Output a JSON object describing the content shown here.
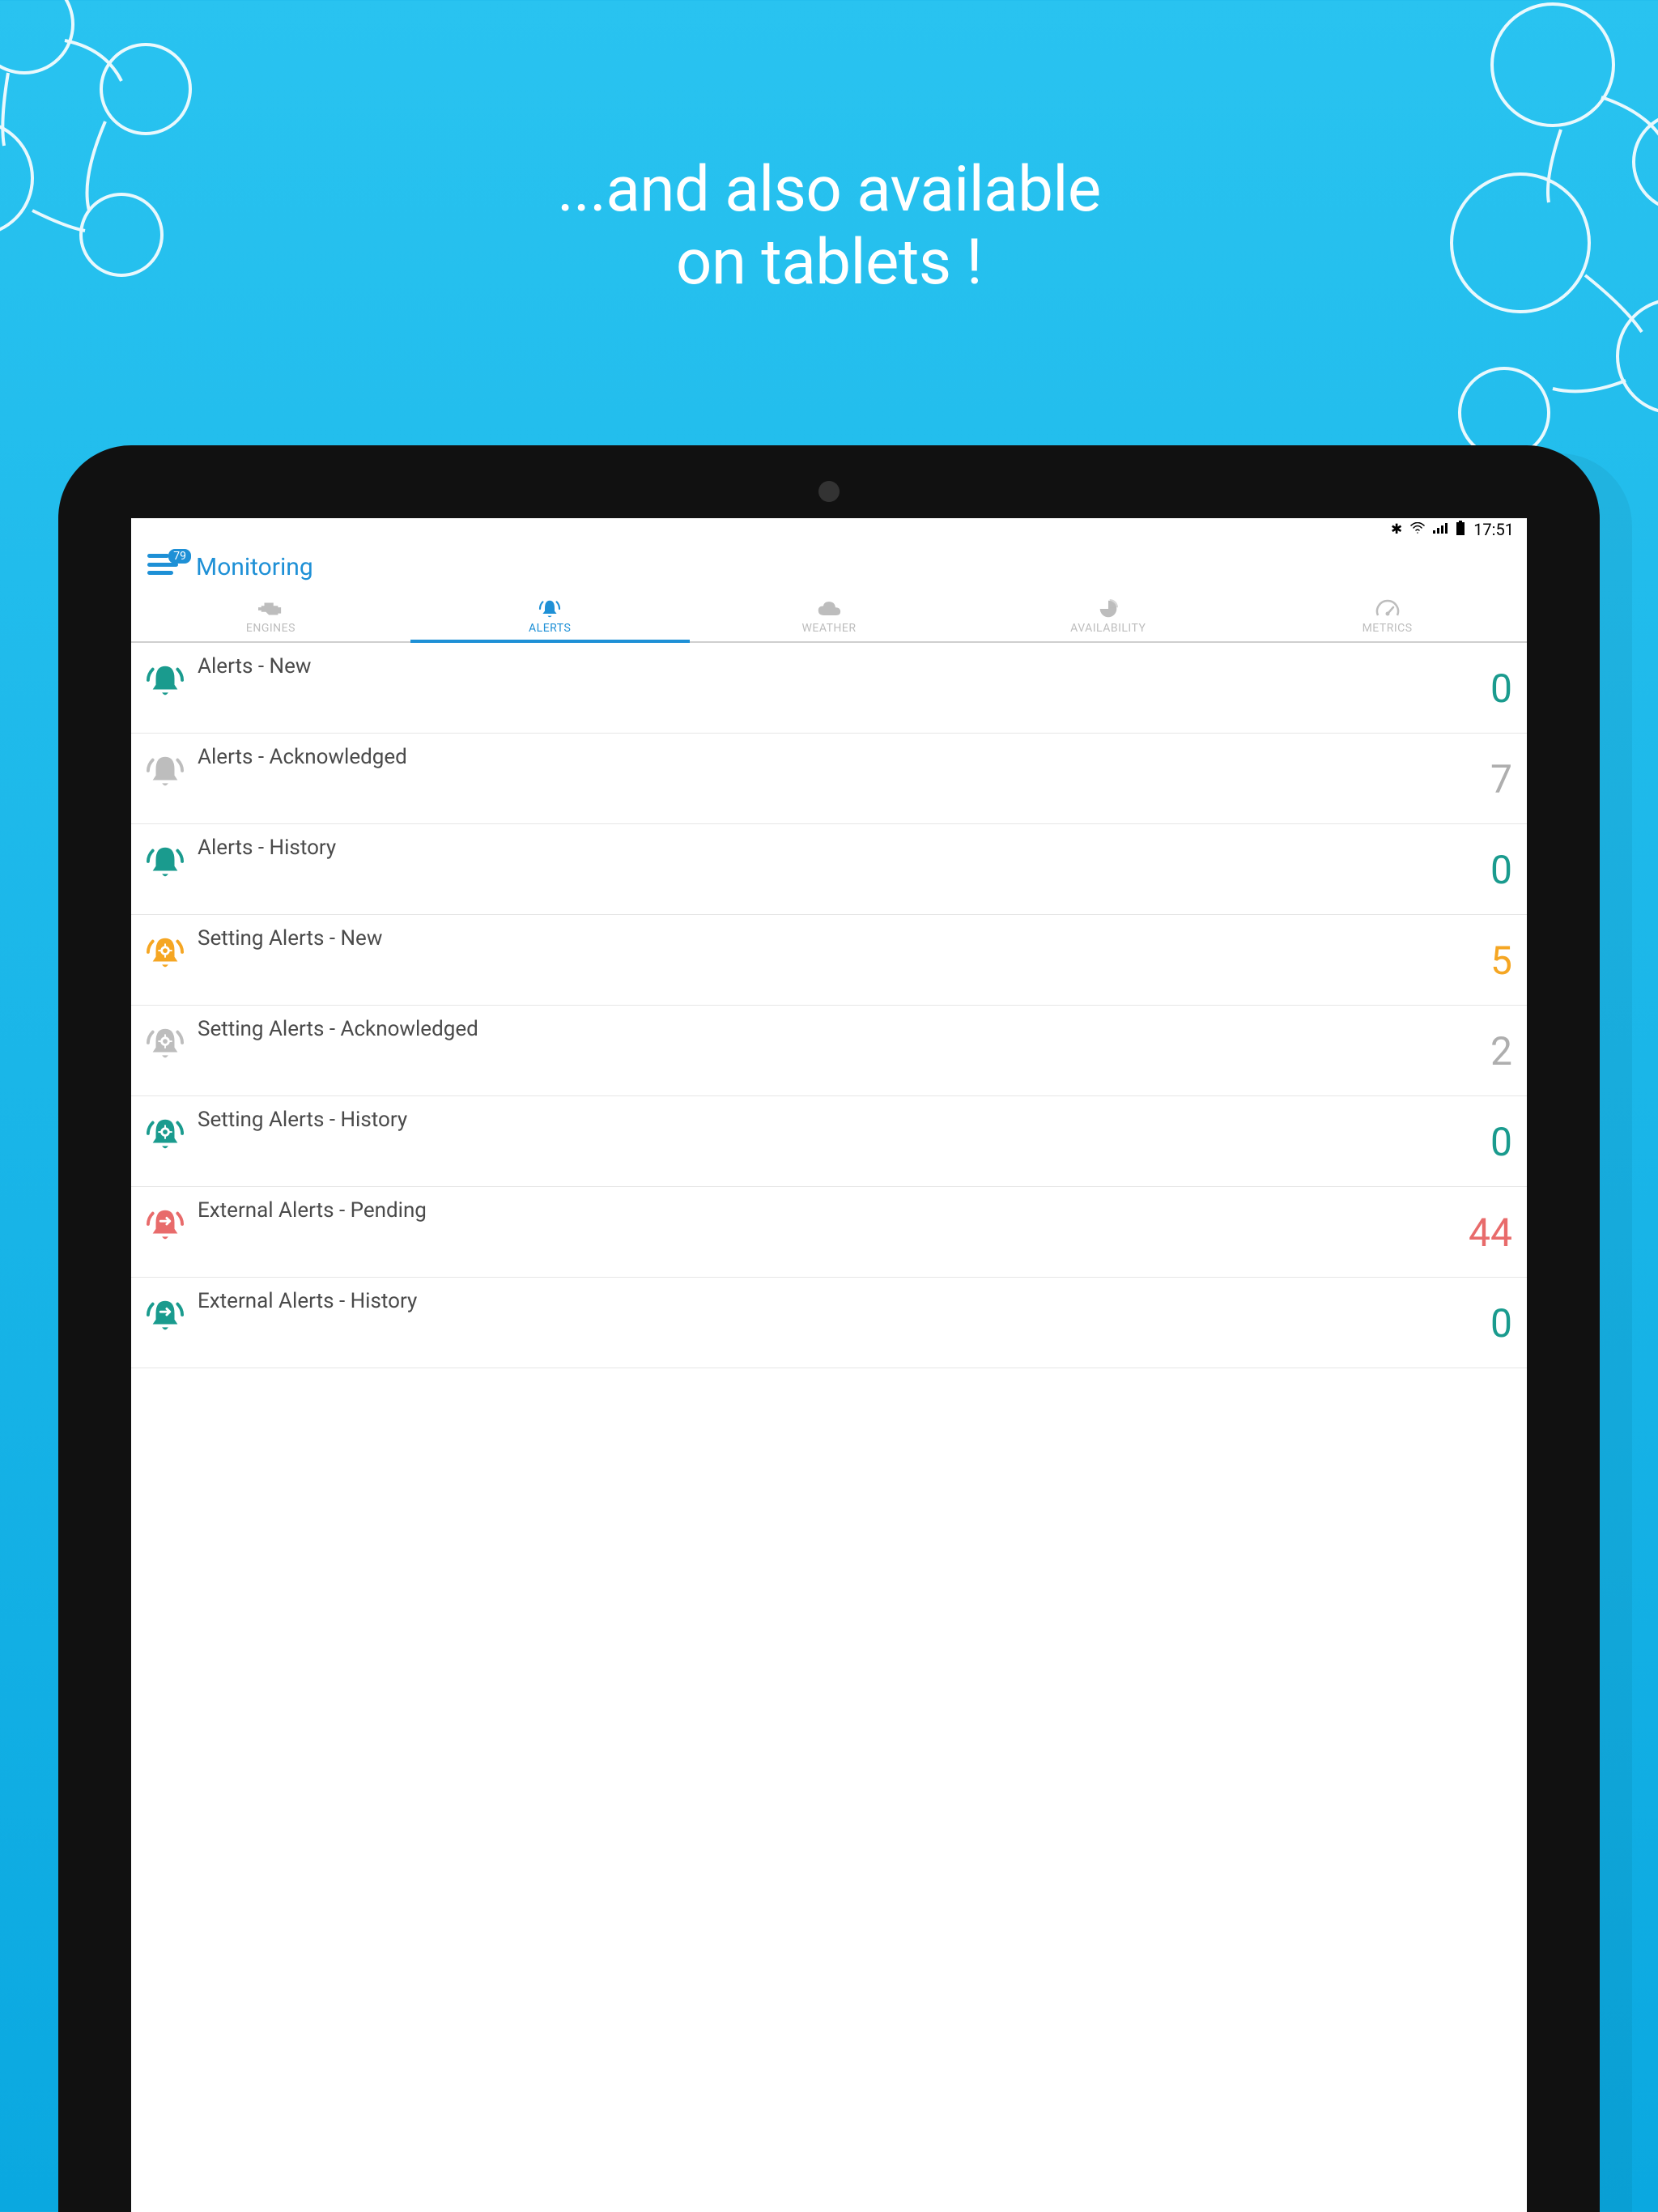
{
  "promo": {
    "line1": "...and also available",
    "line2": "on tablets !"
  },
  "statusbar": {
    "time": "17:51"
  },
  "menu_badge": "79",
  "app_title": "Monitoring",
  "tabs": [
    {
      "id": "engines",
      "label": "ENGINES",
      "active": false
    },
    {
      "id": "alerts",
      "label": "ALERTS",
      "active": true
    },
    {
      "id": "weather",
      "label": "WEATHER",
      "active": false
    },
    {
      "id": "availability",
      "label": "AVAILABILITY",
      "active": false
    },
    {
      "id": "metrics",
      "label": "METRICS",
      "active": false
    }
  ],
  "rows": [
    {
      "title": "Alerts - New",
      "count": "0",
      "count_color": "c-teal",
      "icon": "bell",
      "icon_color": "#1a9b8e"
    },
    {
      "title": "Alerts - Acknowledged",
      "count": "7",
      "count_color": "c-gray",
      "icon": "bell",
      "icon_color": "#bdbdbd"
    },
    {
      "title": "Alerts - History",
      "count": "0",
      "count_color": "c-teal",
      "icon": "bell",
      "icon_color": "#1a9b8e"
    },
    {
      "title": "Setting Alerts - New",
      "count": "5",
      "count_color": "c-orange",
      "icon": "bell-gear",
      "icon_color": "#f5a623"
    },
    {
      "title": "Setting Alerts - Acknowledged",
      "count": "2",
      "count_color": "c-gray",
      "icon": "bell-gear",
      "icon_color": "#bdbdbd"
    },
    {
      "title": "Setting Alerts - History",
      "count": "0",
      "count_color": "c-teal",
      "icon": "bell-gear",
      "icon_color": "#1a9b8e"
    },
    {
      "title": "External Alerts - Pending",
      "count": "44",
      "count_color": "c-red",
      "icon": "bell-ext",
      "icon_color": "#e86b6b"
    },
    {
      "title": "External Alerts - History",
      "count": "0",
      "count_color": "c-teal",
      "icon": "bell-ext",
      "icon_color": "#1a9b8e"
    }
  ]
}
